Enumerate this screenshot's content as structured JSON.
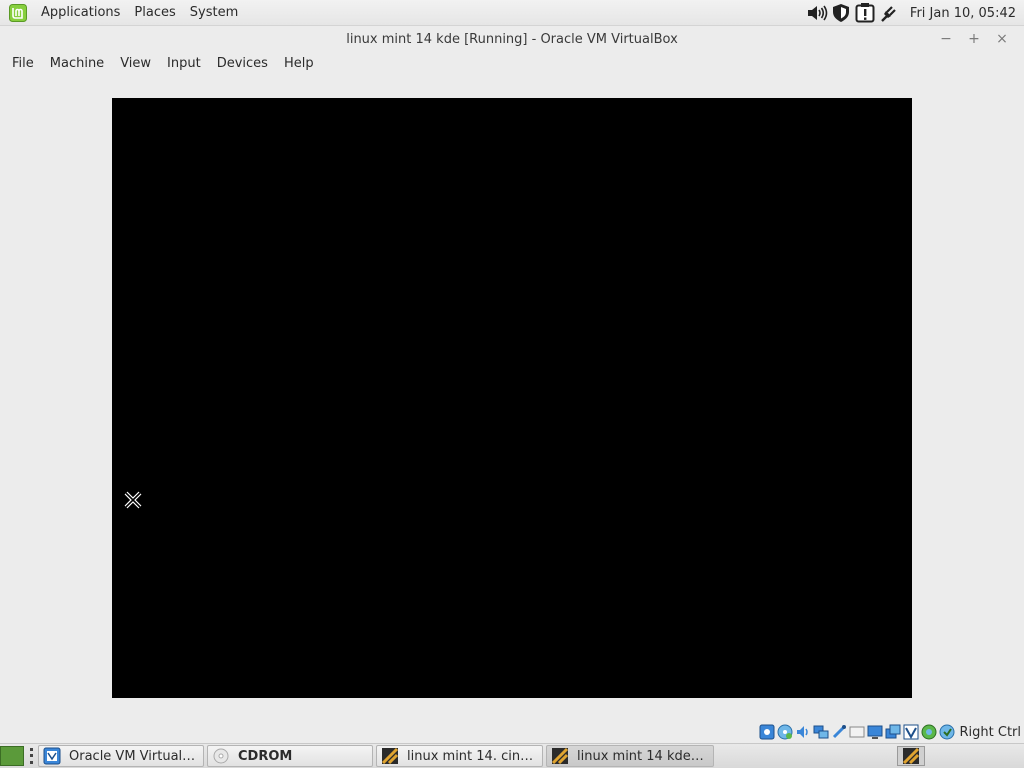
{
  "top_panel": {
    "menus": [
      "Applications",
      "Places",
      "System"
    ],
    "clock": "Fri Jan 10, 05:42",
    "tray_icons": [
      "volume-icon",
      "shield-icon",
      "update-icon",
      "network-icon"
    ]
  },
  "window": {
    "title": "linux mint 14 kde [Running] - Oracle VM VirtualBox",
    "controls": {
      "minimize": "−",
      "maximize": "+",
      "close": "×"
    }
  },
  "menu_bar": {
    "items": [
      "File",
      "Machine",
      "View",
      "Input",
      "Devices",
      "Help"
    ]
  },
  "vm_display": {
    "background": "#000000"
  },
  "status_bar": {
    "icons": [
      "hard-disk-icon",
      "optical-drive-icon",
      "audio-icon",
      "network-adapter-icon",
      "usb-icon",
      "shared-folders-icon",
      "display-icon",
      "video-capture-icon",
      "virtualization-icon",
      "mouse-integration-icon",
      "keyboard-capture-icon"
    ],
    "host_key": "Right Ctrl"
  },
  "taskbar": {
    "tasks": [
      {
        "label": "Oracle VM VirtualB…",
        "icon": "virtualbox-manager-icon"
      },
      {
        "label": "CDROM",
        "icon": "cdrom-icon"
      },
      {
        "label": "linux mint 14. cinn [...",
        "icon": "virtualbox-vm-icon"
      },
      {
        "label": "linux mint 14 kde [R...",
        "icon": "virtualbox-vm-icon"
      }
    ]
  },
  "colors": {
    "mint_green": "#87cf3e",
    "panel_bg": "#ececec",
    "vm_black": "#000000"
  }
}
